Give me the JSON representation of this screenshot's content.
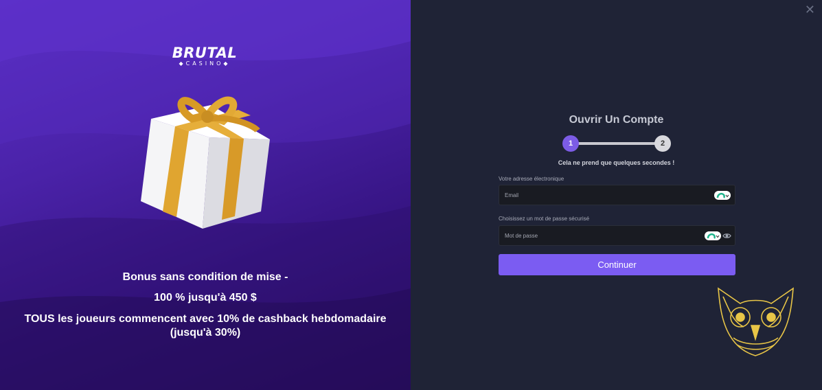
{
  "brand": {
    "name": "BRUTAL",
    "sub": "CASINO"
  },
  "promo": {
    "line1": "Bonus sans condition de mise -",
    "line2": "100 % jusqu'à 450 $",
    "line3": "TOUS les joueurs commencent avec 10% de cashback hebdomadaire (jusqu'à 30%)"
  },
  "form": {
    "title": "Ouvrir Un Compte",
    "steps": [
      "1",
      "2"
    ],
    "current_step": 1,
    "subtitle": "Cela ne prend que quelques secondes !",
    "email_label": "Votre adresse électronique",
    "email_placeholder": "Email",
    "password_label": "Choisissez un mot de passe sécurisé",
    "password_placeholder": "Mot de passe",
    "submit_label": "Continuer"
  },
  "icons": {
    "close": "close-icon",
    "gift": "gift-icon",
    "owl": "owl-logo-icon",
    "eye": "eye-icon",
    "password_manager": "password-manager-icon"
  },
  "colors": {
    "accent": "#7b5cf2",
    "panel_bg": "#1f2336",
    "promo_bg": "#4a22a8",
    "owl_gold": "#e8c547"
  }
}
